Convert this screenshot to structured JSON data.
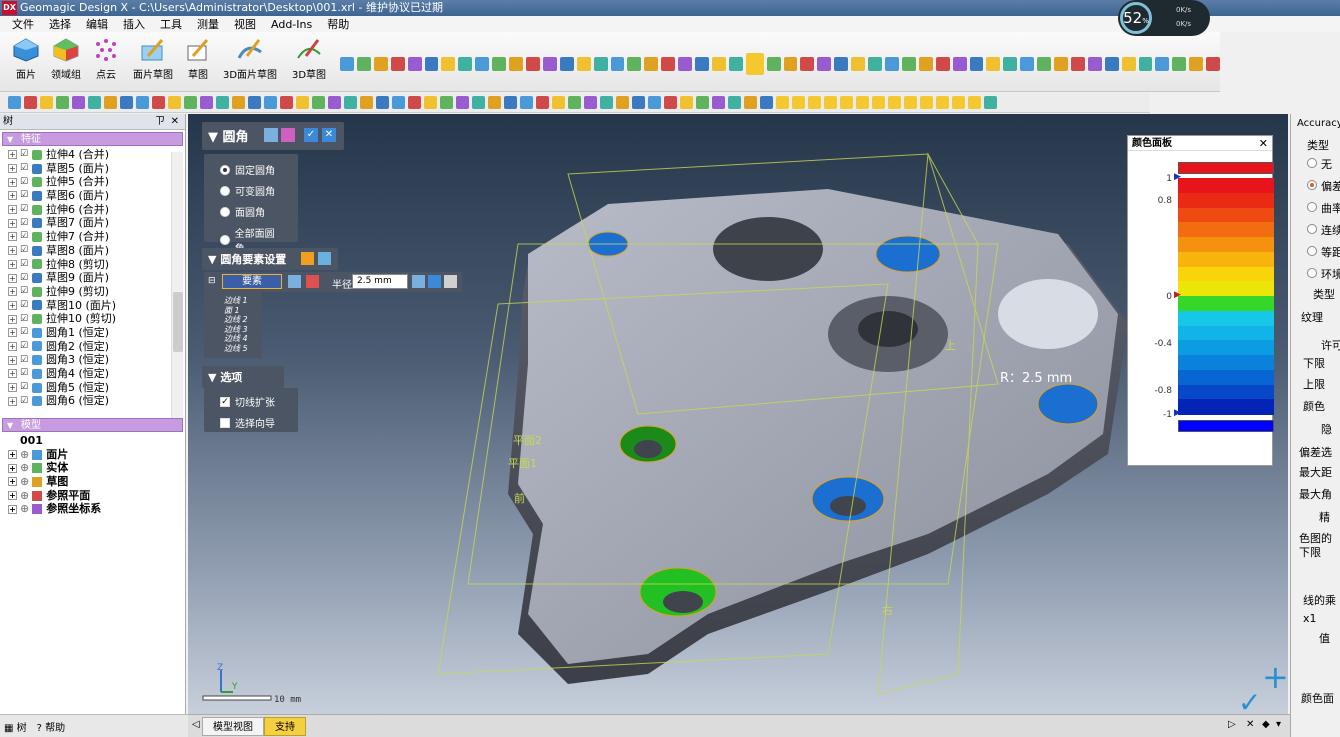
{
  "app": {
    "logo": "DX",
    "title": "Geomagic Design X - C:\\Users\\Administrator\\Desktop\\001.xrl - 维护协议已过期"
  },
  "menu": [
    "文件",
    "选择",
    "编辑",
    "插入",
    "工具",
    "测量",
    "视图",
    "Add-Ins",
    "帮助"
  ],
  "ribbon": {
    "buttons": [
      "面片",
      "领域组",
      "点云",
      "面片草图",
      "草图",
      "3D面片草图",
      "3D草图"
    ]
  },
  "performance": {
    "percent": "52",
    "unit": "%",
    "rate1": "0K/s",
    "rate2": "0K/s"
  },
  "tree_panel": {
    "title": "树",
    "pin": "ㄗ",
    "close": "✕",
    "features_header": "特征",
    "features": [
      {
        "label": "拉伸4 (合并)",
        "icon": "extrude-icon"
      },
      {
        "label": "草图5 (面片)",
        "icon": "sketch-icon"
      },
      {
        "label": "拉伸5 (合并)",
        "icon": "extrude-icon"
      },
      {
        "label": "草图6 (面片)",
        "icon": "sketch-icon"
      },
      {
        "label": "拉伸6 (合并)",
        "icon": "extrude-icon"
      },
      {
        "label": "草图7 (面片)",
        "icon": "sketch-icon"
      },
      {
        "label": "拉伸7 (合并)",
        "icon": "extrude-icon"
      },
      {
        "label": "草图8 (面片)",
        "icon": "sketch-icon"
      },
      {
        "label": "拉伸8 (剪切)",
        "icon": "extrude-icon"
      },
      {
        "label": "草图9 (面片)",
        "icon": "sketch-icon"
      },
      {
        "label": "拉伸9 (剪切)",
        "icon": "extrude-icon"
      },
      {
        "label": "草图10 (面片)",
        "icon": "sketch-icon"
      },
      {
        "label": "拉伸10 (剪切)",
        "icon": "extrude-icon"
      },
      {
        "label": "圆角1 (恒定)",
        "icon": "fillet-icon"
      },
      {
        "label": "圆角2 (恒定)",
        "icon": "fillet-icon"
      },
      {
        "label": "圆角3 (恒定)",
        "icon": "fillet-icon"
      },
      {
        "label": "圆角4 (恒定)",
        "icon": "fillet-icon"
      },
      {
        "label": "圆角5 (恒定)",
        "icon": "fillet-icon"
      },
      {
        "label": "圆角6 (恒定)",
        "icon": "fillet-icon"
      }
    ],
    "model_header": "模型",
    "model_root": "001",
    "model_items": [
      "面片",
      "实体",
      "草图",
      "参照平面",
      "参照坐标系"
    ],
    "bottom_tabs": [
      "树",
      "帮助"
    ]
  },
  "fillet_dialog": {
    "title": "圆角",
    "types": [
      "固定圆角",
      "可变圆角",
      "面圆角",
      "全部面圆角"
    ],
    "selected_type": 0,
    "settings_title": "圆角要素设置",
    "element_label": "要素",
    "radius_label": "半径",
    "radius_value": "2.5 mm",
    "elements": [
      "边线 1",
      "面 1",
      "边线 2",
      "边线 3",
      "边线 4",
      "边线 5"
    ],
    "options_title": "选项",
    "options": [
      {
        "label": "切线扩张",
        "checked": true
      },
      {
        "label": "选择向导",
        "checked": false
      }
    ]
  },
  "viewport": {
    "radius_annotation": "R：2.5 mm",
    "plane_labels": [
      "平面2",
      "平面1",
      "前",
      "上",
      "右"
    ],
    "scale_label": "10 mm",
    "axis_z": "Z",
    "axis_y": "Y"
  },
  "color_palette": {
    "title": "颜色面板",
    "labels": [
      "1",
      "0.8",
      "0",
      "-0.4",
      "-0.8",
      "-1"
    ],
    "colors": [
      "#e8141c",
      "#ea2b14",
      "#ee4a12",
      "#f26c10",
      "#f5910e",
      "#f8b40c",
      "#fad40a",
      "#ece608",
      "#36d62a",
      "#16c8e8",
      "#10b4e6",
      "#0c9ce2",
      "#0a82dc",
      "#0866d4",
      "#0648c8",
      "#0424b8"
    ]
  },
  "right_panel": {
    "title": "Accuracy",
    "type_label": "类型",
    "type_options": [
      {
        "label": "无",
        "selected": false
      },
      {
        "label": "偏差",
        "selected": true
      },
      {
        "label": "曲率",
        "selected": false
      },
      {
        "label": "连续",
        "selected": false
      },
      {
        "label": "等距",
        "selected": false
      },
      {
        "label": "环境",
        "selected": false
      }
    ],
    "labels": [
      "类型",
      "纹理",
      "许可",
      "下限",
      "上限",
      "颜色",
      "隐",
      "偏差选",
      "最大距",
      "最大角",
      "精",
      "色图的",
      "下限",
      "线的乘",
      "x1",
      "值",
      "颜色面"
    ]
  },
  "status_tabs": [
    "模型视图",
    "支持"
  ]
}
